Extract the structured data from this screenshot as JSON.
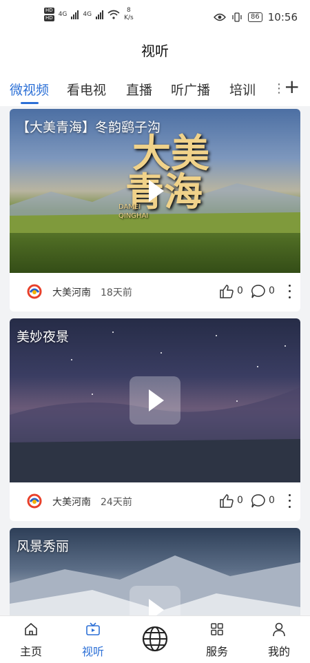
{
  "status_bar": {
    "hd1": "HD",
    "hd2": "HD",
    "net1": "4G",
    "net2": "4G",
    "speed_value": "8",
    "speed_unit": "K/s",
    "battery": "86",
    "time": "10:56"
  },
  "header": {
    "title": "视听"
  },
  "tabs": [
    {
      "label": "微视频",
      "active": true
    },
    {
      "label": "看电视"
    },
    {
      "label": "直播"
    },
    {
      "label": "听广播"
    },
    {
      "label": "培训"
    }
  ],
  "feed": [
    {
      "title": "【大美青海】冬韵鹞子沟",
      "source": "大美河南",
      "time": "18天前",
      "likes": "0",
      "comments": "0"
    },
    {
      "title": "美妙夜景",
      "source": "大美河南",
      "time": "24天前",
      "likes": "0",
      "comments": "0"
    },
    {
      "title": "风景秀丽"
    }
  ],
  "video_overlay": {
    "logo_line1": "大美",
    "logo_line2": "青海",
    "logo_latin": "DAMEI QINGHAI"
  },
  "bottom_nav": [
    {
      "label": "主页",
      "icon": "home-icon"
    },
    {
      "label": "视听",
      "icon": "tv-icon",
      "active": true
    },
    {
      "label": "",
      "icon": "globe-icon"
    },
    {
      "label": "服务",
      "icon": "grid-icon"
    },
    {
      "label": "我的",
      "icon": "user-icon"
    }
  ],
  "colors": {
    "accent": "#2b6fd6"
  }
}
